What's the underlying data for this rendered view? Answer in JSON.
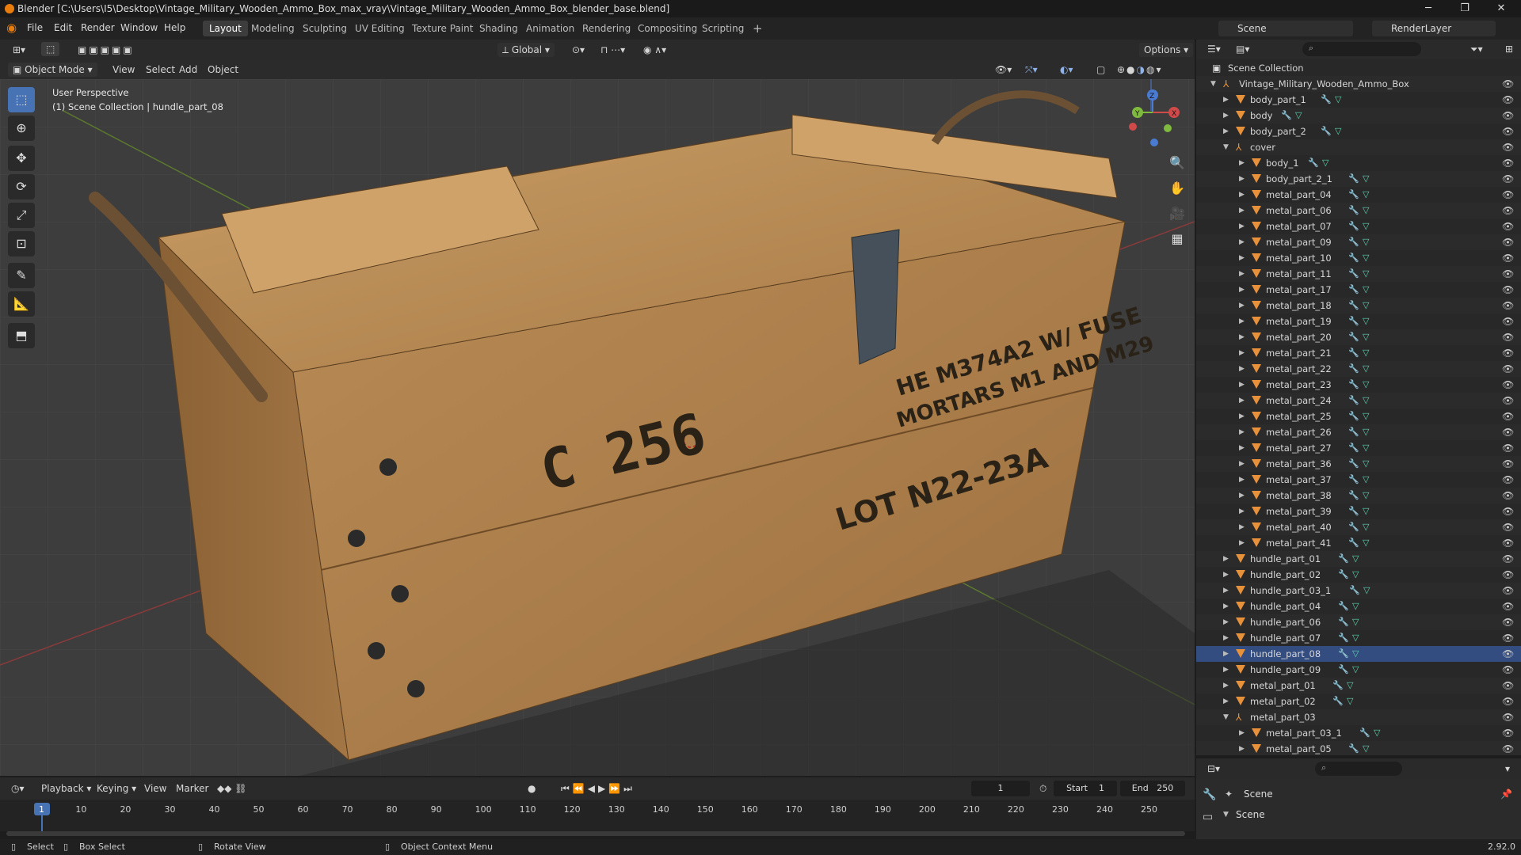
{
  "title": "Blender [C:\\Users\\I5\\Desktop\\Vintage_Military_Wooden_Ammo_Box_max_vray\\Vintage_Military_Wooden_Ammo_Box_blender_base.blend]",
  "menus": [
    "File",
    "Edit",
    "Render",
    "Window",
    "Help"
  ],
  "workspaces": [
    "Layout",
    "Modeling",
    "Sculpting",
    "UV Editing",
    "Texture Paint",
    "Shading",
    "Animation",
    "Rendering",
    "Compositing",
    "Scripting"
  ],
  "active_workspace": "Layout",
  "scene_name": "Scene",
  "view_layer": "RenderLayer",
  "transform_orientation": "Global",
  "options_label": "Options",
  "viewport": {
    "mode": "Object Mode",
    "menus": [
      "View",
      "Select",
      "Add",
      "Object"
    ],
    "perspective_label": "User Perspective",
    "context_label": "(1) Scene Collection | hundle_part_08",
    "box_text": {
      "id": "C 256",
      "line1": "HE M374A2 W/ FUSE",
      "line2": "MORTARS M1 AND M29",
      "lot": "LOT N22-23A"
    },
    "gizmo": {
      "x": "X",
      "y": "Y",
      "z": "Z"
    }
  },
  "outliner": {
    "root": "Scene Collection",
    "collection": "Vintage_Military_Wooden_Ammo_Box",
    "items": [
      {
        "label": "body_part_1",
        "depth": 1,
        "expanded": false
      },
      {
        "label": "body",
        "depth": 1,
        "expanded": false
      },
      {
        "label": "body_part_2",
        "depth": 1,
        "expanded": false
      },
      {
        "label": "cover",
        "depth": 1,
        "expanded": true,
        "empty": true
      },
      {
        "label": "body_1",
        "depth": 2,
        "expanded": false
      },
      {
        "label": "body_part_2_1",
        "depth": 2,
        "expanded": false
      },
      {
        "label": "metal_part_04",
        "depth": 2,
        "expanded": false
      },
      {
        "label": "metal_part_06",
        "depth": 2,
        "expanded": false
      },
      {
        "label": "metal_part_07",
        "depth": 2,
        "expanded": false
      },
      {
        "label": "metal_part_09",
        "depth": 2,
        "expanded": false
      },
      {
        "label": "metal_part_10",
        "depth": 2,
        "expanded": false
      },
      {
        "label": "metal_part_11",
        "depth": 2,
        "expanded": false
      },
      {
        "label": "metal_part_17",
        "depth": 2,
        "expanded": false
      },
      {
        "label": "metal_part_18",
        "depth": 2,
        "expanded": false
      },
      {
        "label": "metal_part_19",
        "depth": 2,
        "expanded": false
      },
      {
        "label": "metal_part_20",
        "depth": 2,
        "expanded": false
      },
      {
        "label": "metal_part_21",
        "depth": 2,
        "expanded": false
      },
      {
        "label": "metal_part_22",
        "depth": 2,
        "expanded": false
      },
      {
        "label": "metal_part_23",
        "depth": 2,
        "expanded": false
      },
      {
        "label": "metal_part_24",
        "depth": 2,
        "expanded": false
      },
      {
        "label": "metal_part_25",
        "depth": 2,
        "expanded": false
      },
      {
        "label": "metal_part_26",
        "depth": 2,
        "expanded": false
      },
      {
        "label": "metal_part_27",
        "depth": 2,
        "expanded": false
      },
      {
        "label": "metal_part_36",
        "depth": 2,
        "expanded": false
      },
      {
        "label": "metal_part_37",
        "depth": 2,
        "expanded": false
      },
      {
        "label": "metal_part_38",
        "depth": 2,
        "expanded": false
      },
      {
        "label": "metal_part_39",
        "depth": 2,
        "expanded": false
      },
      {
        "label": "metal_part_40",
        "depth": 2,
        "expanded": false
      },
      {
        "label": "metal_part_41",
        "depth": 2,
        "expanded": false
      },
      {
        "label": "hundle_part_01",
        "depth": 1,
        "expanded": false
      },
      {
        "label": "hundle_part_02",
        "depth": 1,
        "expanded": false
      },
      {
        "label": "hundle_part_03_1",
        "depth": 1,
        "expanded": false
      },
      {
        "label": "hundle_part_04",
        "depth": 1,
        "expanded": false
      },
      {
        "label": "hundle_part_06",
        "depth": 1,
        "expanded": false
      },
      {
        "label": "hundle_part_07",
        "depth": 1,
        "expanded": false
      },
      {
        "label": "hundle_part_08",
        "depth": 1,
        "expanded": false,
        "active": true
      },
      {
        "label": "hundle_part_09",
        "depth": 1,
        "expanded": false
      },
      {
        "label": "metal_part_01",
        "depth": 1,
        "expanded": false
      },
      {
        "label": "metal_part_02",
        "depth": 1,
        "expanded": false
      },
      {
        "label": "metal_part_03",
        "depth": 1,
        "expanded": true,
        "empty": true
      },
      {
        "label": "metal_part_03_1",
        "depth": 2,
        "expanded": false
      },
      {
        "label": "metal_part_05",
        "depth": 2,
        "expanded": false
      }
    ]
  },
  "properties": {
    "scene_label": "Scene",
    "section_label": "Scene"
  },
  "timeline": {
    "menus": [
      "Playback",
      "Keying",
      "View",
      "Marker"
    ],
    "current_frame": "1",
    "start_label": "Start",
    "start": "1",
    "end_label": "End",
    "end": "250",
    "ticks": [
      "1",
      "10",
      "20",
      "30",
      "40",
      "50",
      "60",
      "70",
      "80",
      "90",
      "100",
      "110",
      "120",
      "130",
      "140",
      "150",
      "160",
      "170",
      "180",
      "190",
      "200",
      "210",
      "220",
      "230",
      "240",
      "250"
    ]
  },
  "statusbar": {
    "select": "Select",
    "box_select": "Box Select",
    "rotate_view": "Rotate View",
    "context_menu": "Object Context Menu",
    "version": "2.92.0"
  },
  "colors": {
    "accent": "#4772b3",
    "object_icon": "#e8913b",
    "mesh_icon": "#5fd1b0",
    "wrench_icon": "#8fb3e8"
  }
}
